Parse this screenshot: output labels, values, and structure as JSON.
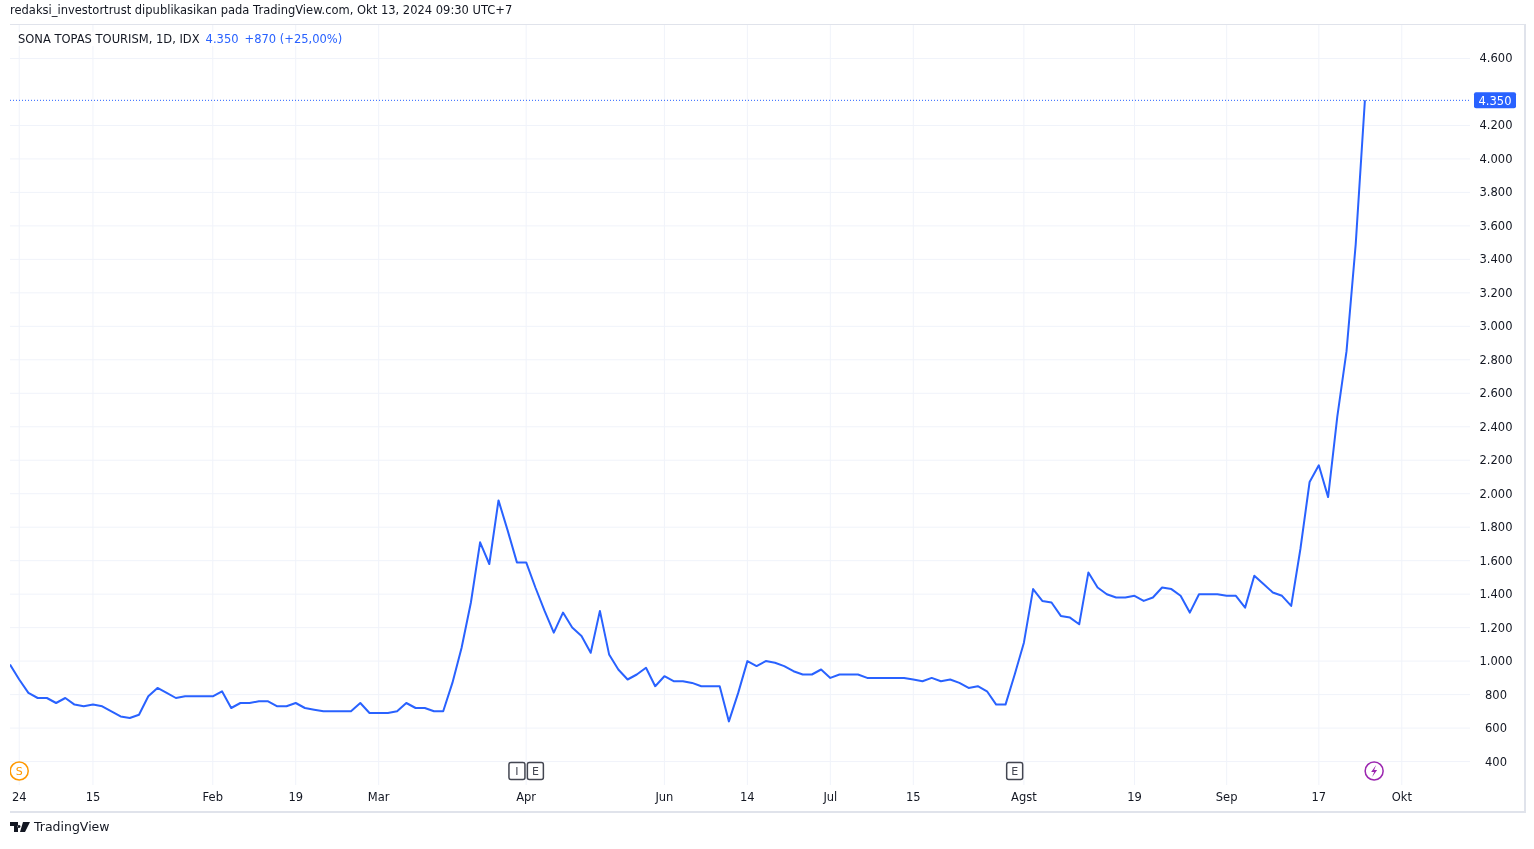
{
  "header": {
    "text": "redaksi_investortrust dipublikasikan pada TradingView.com, Okt 13, 2024 09:30 UTC+7"
  },
  "legend": {
    "symbol": "SONA TOPAS TOURISM, 1D, IDX",
    "price": "4.350",
    "change": "+870 (+25,00%)"
  },
  "chart": {
    "chart_data": {
      "type": "line",
      "categories": [
        null,
        "24",
        null,
        null,
        null,
        null,
        null,
        null,
        null,
        "15",
        null,
        null,
        null,
        null,
        null,
        null,
        null,
        null,
        null,
        null,
        null,
        null,
        "Feb",
        null,
        null,
        null,
        null,
        null,
        null,
        null,
        null,
        "19",
        null,
        null,
        null,
        null,
        null,
        null,
        null,
        null,
        "Mar",
        null,
        null,
        null,
        null,
        null,
        null,
        null,
        null,
        null,
        null,
        null,
        null,
        null,
        null,
        null,
        "Apr",
        null,
        null,
        null,
        null,
        null,
        null,
        null,
        null,
        null,
        null,
        null,
        null,
        null,
        null,
        "Jun",
        null,
        null,
        null,
        null,
        null,
        null,
        null,
        null,
        "14",
        null,
        null,
        null,
        null,
        null,
        null,
        null,
        null,
        "Jul",
        null,
        null,
        null,
        null,
        null,
        null,
        null,
        null,
        "15",
        null,
        null,
        null,
        null,
        null,
        null,
        null,
        null,
        null,
        null,
        null,
        "Agst",
        null,
        null,
        null,
        null,
        null,
        null,
        null,
        null,
        null,
        null,
        null,
        "19",
        null,
        null,
        null,
        null,
        null,
        null,
        null,
        null,
        null,
        "Sep",
        null,
        null,
        null,
        null,
        null,
        null,
        null,
        null,
        null,
        "17",
        null,
        null,
        null,
        null,
        null,
        null,
        null,
        null,
        "Okt",
        null,
        null,
        null,
        null,
        null,
        null,
        null
      ],
      "series": [
        {
          "color": "#2962ff",
          "values": [
            980,
            890,
            810,
            780,
            780,
            750,
            780,
            740,
            730,
            740,
            730,
            700,
            670,
            660,
            680,
            790,
            840,
            810,
            780,
            790,
            790,
            790,
            790,
            820,
            720,
            750,
            750,
            760,
            760,
            730,
            730,
            750,
            720,
            710,
            700,
            700,
            700,
            700,
            750,
            690,
            690,
            690,
            700,
            750,
            720,
            720,
            700,
            700,
            870,
            1080,
            1350,
            1710,
            1580,
            1960,
            1780,
            1590,
            1590,
            1440,
            1300,
            1170,
            1290,
            1200,
            1150,
            1050,
            1300,
            1040,
            950,
            890,
            920,
            960,
            850,
            910,
            880,
            880,
            870,
            850,
            850,
            850,
            640,
            810,
            1000,
            970,
            1000,
            990,
            970,
            940,
            920,
            920,
            950,
            900,
            920,
            920,
            920,
            900,
            900,
            900,
            900,
            900,
            890,
            880,
            900,
            880,
            890,
            870,
            840,
            850,
            820,
            740,
            740,
            920,
            1110,
            1430,
            1360,
            1350,
            1270,
            1260,
            1220,
            1530,
            1440,
            1400,
            1380,
            1380,
            1390,
            1360,
            1380,
            1440,
            1430,
            1390,
            1290,
            1400,
            1400,
            1400,
            1390,
            1390,
            1320,
            1510,
            1460,
            1410,
            1390,
            1330,
            1670,
            2070,
            2170,
            1980,
            2460,
            2850,
            3490,
            4350,
            null,
            null,
            null,
            null,
            null,
            null,
            null,
            null,
            null,
            null,
            null
          ]
        }
      ],
      "ylim": [
        260,
        4800
      ],
      "yticks": [
        {
          "value": 400,
          "label": "400"
        },
        {
          "value": 600,
          "label": "600"
        },
        {
          "value": 800,
          "label": "800"
        },
        {
          "value": 1000,
          "label": "1.000"
        },
        {
          "value": 1200,
          "label": "1.200"
        },
        {
          "value": 1400,
          "label": "1.400"
        },
        {
          "value": 1600,
          "label": "1.600"
        },
        {
          "value": 1800,
          "label": "1.800"
        },
        {
          "value": 2000,
          "label": "2.000"
        },
        {
          "value": 2200,
          "label": "2.200"
        },
        {
          "value": 2400,
          "label": "2.400"
        },
        {
          "value": 2600,
          "label": "2.600"
        },
        {
          "value": 2800,
          "label": "2.800"
        },
        {
          "value": 3000,
          "label": "3.000"
        },
        {
          "value": 3200,
          "label": "3.200"
        },
        {
          "value": 3400,
          "label": "3.400"
        },
        {
          "value": 3600,
          "label": "3.600"
        },
        {
          "value": 3800,
          "label": "3.800"
        },
        {
          "value": 4000,
          "label": "4.000"
        },
        {
          "value": 4200,
          "label": "4.200"
        },
        {
          "value": 4600,
          "label": "4.600"
        }
      ],
      "grid": true,
      "ref_lines": [
        {
          "axis": "y",
          "value": 4350,
          "label": "4.350"
        }
      ]
    },
    "events": [
      {
        "kind": "circle",
        "text": "S",
        "color": "#ff9800"
      },
      {
        "kind": "box",
        "text": "I",
        "color": "#434651"
      },
      {
        "kind": "box",
        "text": "E",
        "color": "#434651"
      },
      {
        "kind": "box",
        "text": "E",
        "color": "#434651"
      },
      {
        "kind": "bolt",
        "color": "#9c27b0"
      }
    ]
  },
  "footer": {
    "brand": "TradingView"
  }
}
